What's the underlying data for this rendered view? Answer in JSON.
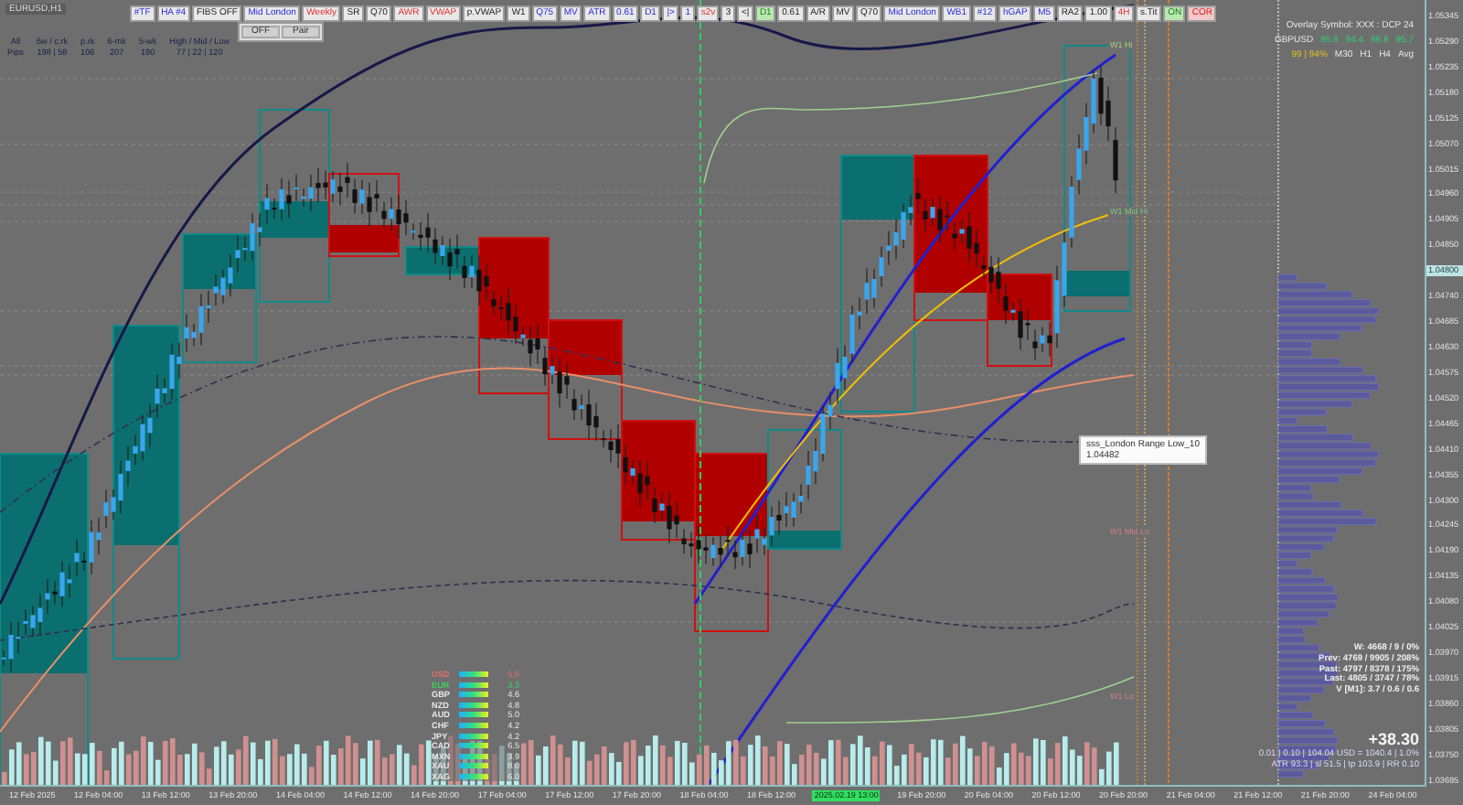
{
  "window": {
    "title": "EURUSD,H1"
  },
  "stats_header": {
    "label_top": "All",
    "label_bottom": "Pips",
    "columns": [
      {
        "heading": "6w / c.rk",
        "value": "198 | 58"
      },
      {
        "heading": "p.rk",
        "value": "106"
      },
      {
        "heading": "6-mk",
        "value": "207"
      },
      {
        "heading": "5-wk",
        "value": "190"
      },
      {
        "heading": "High / Mid / Low",
        "value": "77 | 22 | 120"
      }
    ]
  },
  "toolbar": [
    {
      "label": "#TF",
      "kind": "blue"
    },
    {
      "label": "HA #4",
      "kind": "blue"
    },
    {
      "label": "FIBS OFF",
      "kind": "plain"
    },
    {
      "label": "Mid London",
      "kind": "blue"
    },
    {
      "label": "Weekly",
      "kind": "red"
    },
    {
      "label": "SR",
      "kind": "plain"
    },
    {
      "label": "Q70",
      "kind": "plain"
    },
    {
      "label": "AWR",
      "kind": "red"
    },
    {
      "label": "VWAP",
      "kind": "red"
    },
    {
      "label": "p.VWAP",
      "kind": "plain"
    },
    {
      "label": "W1",
      "kind": "plain"
    },
    {
      "label": "Q75",
      "kind": "blue"
    },
    {
      "label": "MV",
      "kind": "blue"
    },
    {
      "label": "ATR",
      "kind": "blue"
    },
    {
      "label": "0.61",
      "kind": "blue"
    },
    {
      "label": "D1",
      "kind": "blue"
    },
    {
      "label": "|>",
      "kind": "blue"
    },
    {
      "label": "1",
      "kind": "blue"
    },
    {
      "label": "s2v",
      "kind": "red"
    },
    {
      "label": "3",
      "kind": "plain"
    },
    {
      "label": "<|",
      "kind": "plain"
    },
    {
      "label": "D1",
      "kind": "on"
    },
    {
      "label": "0.61",
      "kind": "plain"
    },
    {
      "label": "A/R",
      "kind": "plain"
    },
    {
      "label": "MV",
      "kind": "plain"
    },
    {
      "label": "Q70",
      "kind": "plain"
    },
    {
      "label": "Mid London",
      "kind": "blue"
    },
    {
      "label": "WB1",
      "kind": "blue"
    },
    {
      "label": "#12",
      "kind": "blue"
    },
    {
      "label": "hGAP",
      "kind": "blue"
    },
    {
      "label": "M5",
      "kind": "blue"
    },
    {
      "label": "RA2",
      "kind": "plain"
    },
    {
      "label": "1.00",
      "kind": "plain"
    },
    {
      "label": "4H",
      "kind": "red"
    },
    {
      "label": "s.Tit",
      "kind": "plain"
    },
    {
      "label": "ON",
      "kind": "on"
    },
    {
      "label": "COR",
      "kind": "off"
    }
  ],
  "mode_dropdown": [
    {
      "label": "OFF"
    },
    {
      "label": "Pair"
    }
  ],
  "overlay_panel": {
    "title": "Overlay Symbol: XXX : DCP 24",
    "symbol": "GBPUSD",
    "scores": [
      "95.8",
      "94.4",
      "96.8",
      "95.7"
    ],
    "summary": "99 | 94%",
    "timeframes": [
      "M30",
      "H1",
      "H4",
      "Avg"
    ]
  },
  "level_labels": [
    {
      "text": "W1 Hi",
      "color": "#a0d080"
    },
    {
      "text": "W1 Mid Hi",
      "color": "#80c880"
    },
    {
      "text": "W1 Mid Lo",
      "color": "#d08080"
    },
    {
      "text": "W1 Lo",
      "color": "#d08080"
    }
  ],
  "tooltip": {
    "name": "sss_London Range Low_10",
    "price": "1.04482"
  },
  "currency_strength": [
    {
      "code": "USD",
      "value": "5.6",
      "color": "#e07070"
    },
    {
      "code": "EUR",
      "value": "3.3",
      "color": "#40d060"
    },
    {
      "code": "GBP",
      "value": "4.6",
      "color": "#e8e8e8"
    },
    {
      "code": "NZD",
      "value": "4.8",
      "color": "#e8e8e8"
    },
    {
      "code": "AUD",
      "value": "5.0",
      "color": "#e8e8e8"
    },
    {
      "code": "CHF",
      "value": "4.2",
      "color": "#e8e8e8"
    },
    {
      "code": "JPY",
      "value": "4.2",
      "color": "#e8e8e8"
    },
    {
      "code": "CAD",
      "value": "6.5",
      "color": "#e8e8e8"
    },
    {
      "code": "MXN",
      "value": "3.9",
      "color": "#e8e8e8"
    },
    {
      "code": "XAU",
      "value": "8.0",
      "color": "#e8e8e8"
    },
    {
      "code": "XAG",
      "value": "6.0",
      "color": "#e8e8e8"
    }
  ],
  "account_stats": {
    "lines": [
      "W: 4668 / 9 / 0%",
      "Prev: 4769 / 9905 / 208%",
      "Past: 4797 / 8378 / 175%",
      "Last: 4805 / 3747 / 78%",
      "V [M1]: 3.7 / 0.6 / 0.6"
    ],
    "profit": "+38.30",
    "risk": "0.01 | 0.10 | 104.04 USD = 1040.4 | 1.0%",
    "targets": "ATR 93.3 | sl 51.5 | tp 103.9 | RR 0.10"
  },
  "price_axis": [
    {
      "label": "1.05345",
      "current": false
    },
    {
      "label": "1.05290",
      "current": false
    },
    {
      "label": "1.05235",
      "current": false
    },
    {
      "label": "1.05180",
      "current": false
    },
    {
      "label": "1.05125",
      "current": false
    },
    {
      "label": "1.05070",
      "current": false
    },
    {
      "label": "1.05015",
      "current": false
    },
    {
      "label": "1.04960",
      "current": false
    },
    {
      "label": "1.04905",
      "current": false
    },
    {
      "label": "1.04850",
      "current": false
    },
    {
      "label": "1.04800",
      "current": true
    },
    {
      "label": "1.04740",
      "current": false
    },
    {
      "label": "1.04685",
      "current": false
    },
    {
      "label": "1.04630",
      "current": false
    },
    {
      "label": "1.04575",
      "current": false
    },
    {
      "label": "1.04520",
      "current": false
    },
    {
      "label": "1.04465",
      "current": false
    },
    {
      "label": "1.04410",
      "current": false
    },
    {
      "label": "1.04355",
      "current": false
    },
    {
      "label": "1.04300",
      "current": false
    },
    {
      "label": "1.04245",
      "current": false
    },
    {
      "label": "1.04190",
      "current": false
    },
    {
      "label": "1.04135",
      "current": false
    },
    {
      "label": "1.04080",
      "current": false
    },
    {
      "label": "1.04025",
      "current": false
    },
    {
      "label": "1.03970",
      "current": false
    },
    {
      "label": "1.03915",
      "current": false
    },
    {
      "label": "1.03860",
      "current": false
    },
    {
      "label": "1.03805",
      "current": false
    },
    {
      "label": "1.03750",
      "current": false
    },
    {
      "label": "1.03695",
      "current": false
    }
  ],
  "time_axis": [
    {
      "label": "12 Feb 2025",
      "current": false
    },
    {
      "label": "12 Feb 04:00",
      "current": false
    },
    {
      "label": "13 Feb 12:00",
      "current": false
    },
    {
      "label": "13 Feb 20:00",
      "current": false
    },
    {
      "label": "14 Feb 04:00",
      "current": false
    },
    {
      "label": "14 Feb 12:00",
      "current": false
    },
    {
      "label": "14 Feb 20:00",
      "current": false
    },
    {
      "label": "17 Feb 04:00",
      "current": false
    },
    {
      "label": "17 Feb 12:00",
      "current": false
    },
    {
      "label": "17 Feb 20:00",
      "current": false
    },
    {
      "label": "18 Feb 04:00",
      "current": false
    },
    {
      "label": "18 Feb 12:00",
      "current": false
    },
    {
      "label": "2025.02.19 13:00",
      "current": true
    },
    {
      "label": "19 Feb 20:00",
      "current": false
    },
    {
      "label": "20 Feb 04:00",
      "current": false
    },
    {
      "label": "20 Feb 12:00",
      "current": false
    },
    {
      "label": "20 Feb 20:00",
      "current": false
    },
    {
      "label": "21 Feb 04:00",
      "current": false
    },
    {
      "label": "21 Feb 12:00",
      "current": false
    },
    {
      "label": "21 Feb 20:00",
      "current": false
    },
    {
      "label": "24 Feb 04:00",
      "current": false
    }
  ]
}
